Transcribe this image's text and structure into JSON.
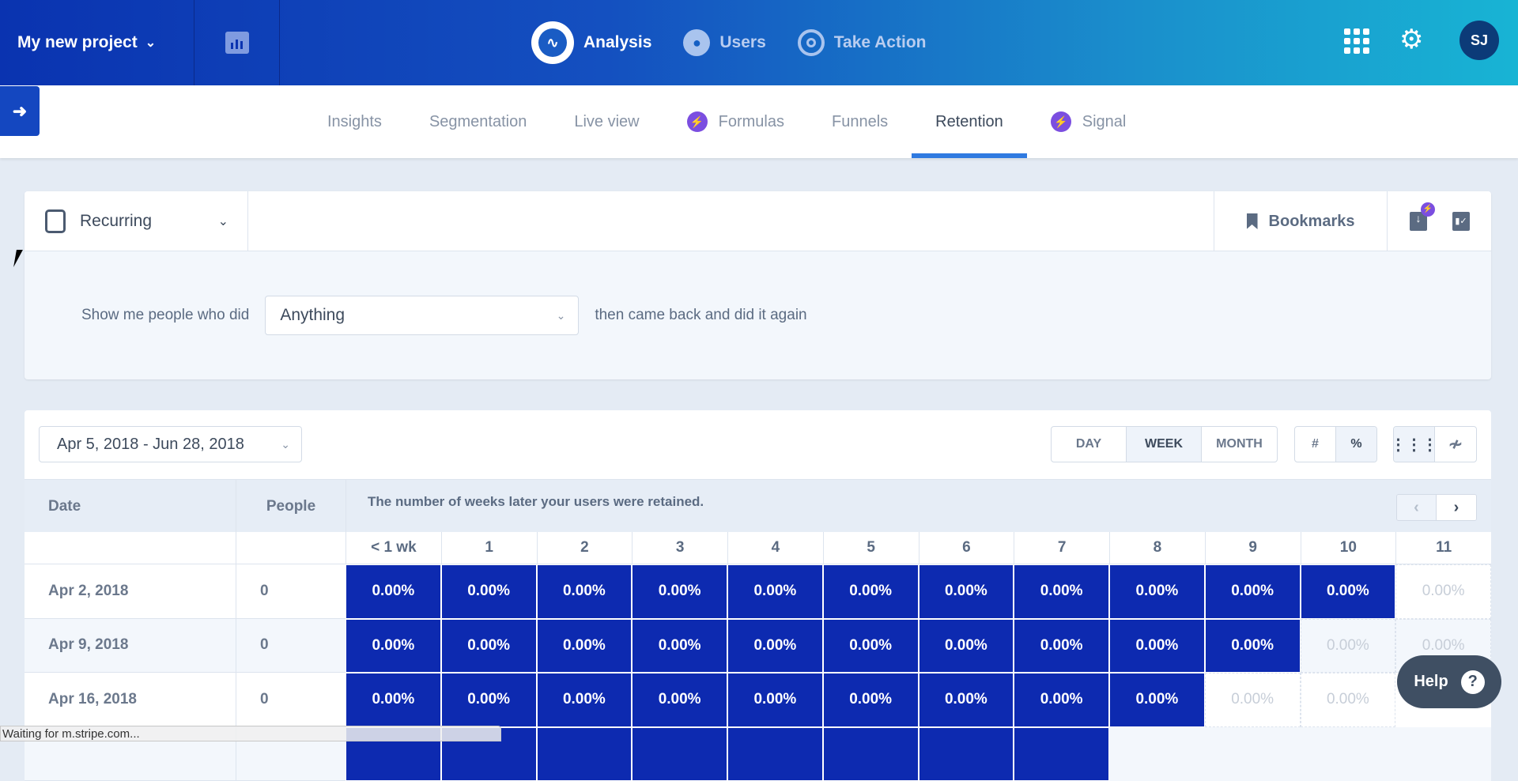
{
  "topbar": {
    "project": "My new project",
    "nav": [
      {
        "label": "Analysis",
        "icon": "pulse-icon",
        "active": true
      },
      {
        "label": "Users",
        "icon": "user-icon",
        "active": false
      },
      {
        "label": "Take Action",
        "icon": "target-icon",
        "active": false
      }
    ],
    "avatar": "SJ"
  },
  "subnav": {
    "tabs": [
      {
        "label": "Insights",
        "bolt": false
      },
      {
        "label": "Segmentation",
        "bolt": false
      },
      {
        "label": "Live view",
        "bolt": false
      },
      {
        "label": "Formulas",
        "bolt": true
      },
      {
        "label": "Funnels",
        "bolt": false
      },
      {
        "label": "Retention",
        "bolt": false,
        "active": true
      },
      {
        "label": "Signal",
        "bolt": true
      }
    ]
  },
  "query": {
    "mode": "Recurring",
    "bookmarks": "Bookmarks",
    "prefix": "Show me people who did",
    "event": "Anything",
    "suffix": "then came back and did it again"
  },
  "report": {
    "date_range": "Apr 5, 2018 - Jun 28, 2018",
    "granularity": [
      "DAY",
      "WEEK",
      "MONTH"
    ],
    "granularity_selected": "WEEK",
    "units": [
      "#",
      "%"
    ],
    "units_selected": "%",
    "view_selected": "grid",
    "headers": {
      "date": "Date",
      "people": "People",
      "note": "The number of weeks later your users were retained."
    },
    "columns": [
      "< 1 wk",
      "1",
      "2",
      "3",
      "4",
      "5",
      "6",
      "7",
      "8",
      "9",
      "10",
      "11"
    ],
    "rows": [
      {
        "date": "Apr 2, 2018",
        "people": "0",
        "filled": 11,
        "empty": 1,
        "value": "0.00%"
      },
      {
        "date": "Apr 9, 2018",
        "people": "0",
        "filled": 10,
        "empty": 2,
        "value": "0.00%"
      },
      {
        "date": "Apr 16, 2018",
        "people": "0",
        "filled": 9,
        "empty": 2,
        "value": "0.00%"
      },
      {
        "date": "",
        "people": "",
        "filled": 8,
        "empty": 0,
        "value": ""
      }
    ],
    "fill_color": "#0d2ab0"
  },
  "help": "Help",
  "status_bar": "Waiting for m.stripe.com..."
}
